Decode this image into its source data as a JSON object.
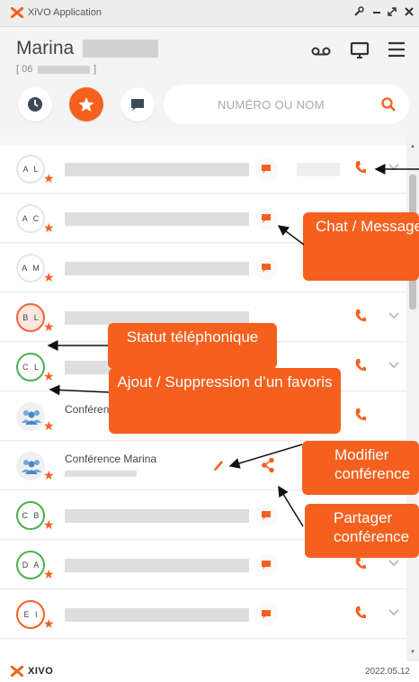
{
  "window": {
    "title": "XiVO Application",
    "controls": [
      "wrench",
      "minimize",
      "maximize",
      "close"
    ]
  },
  "user": {
    "name": "Marina",
    "number_prefix": "[ 06",
    "number_suffix": "]"
  },
  "header_icons": [
    "voicemail-icon",
    "desktop-icon",
    "menu-icon"
  ],
  "nav": {
    "history_icon": "clock-icon",
    "favorites_icon": "star-icon",
    "chat_icon": "message-icon",
    "active": "favorites"
  },
  "search": {
    "placeholder": "NUMÉRO OU NOM"
  },
  "contacts": [
    {
      "initials": "A L",
      "status": "default",
      "chat": true,
      "phone": true,
      "chevron": true,
      "favorite": true
    },
    {
      "initials": "A C",
      "status": "default",
      "chat": true,
      "phone": false,
      "chevron": false,
      "favorite": true
    },
    {
      "initials": "A M",
      "status": "default",
      "chat": true,
      "phone": false,
      "chevron": false,
      "favorite": true
    },
    {
      "initials": "B L",
      "status": "busy",
      "chat": false,
      "phone": true,
      "chevron": true,
      "favorite": true
    },
    {
      "initials": "C L",
      "status": "available",
      "chat": false,
      "phone": true,
      "chevron": true,
      "favorite": true
    },
    {
      "name": "Conférence",
      "type": "conference",
      "phone": true,
      "favorite": true
    },
    {
      "name": "Conférence Marina",
      "type": "conference",
      "edit": true,
      "share": true,
      "favorite": true
    },
    {
      "initials": "C B",
      "status": "available",
      "chat": true,
      "phone": true,
      "chevron": true,
      "favorite": true
    },
    {
      "initials": "D A",
      "status": "available",
      "chat": true,
      "phone": true,
      "chevron": true,
      "favorite": true
    },
    {
      "initials": "E I",
      "status": "offline",
      "chat": true,
      "phone": true,
      "chevron": true,
      "favorite": true
    }
  ],
  "annotations": {
    "chat": "Chat / Messagerie instantanée",
    "status": "Statut téléphonique",
    "favorite": "Ajout / Suppression d’un favoris",
    "edit": "Modifier conférence",
    "share": "Partager conférence"
  },
  "footer": {
    "brand": "XIVO",
    "date": "2022.05.12"
  },
  "colors": {
    "accent": "#f5601e",
    "available": "#4caf50",
    "busy": "#f0623a"
  }
}
